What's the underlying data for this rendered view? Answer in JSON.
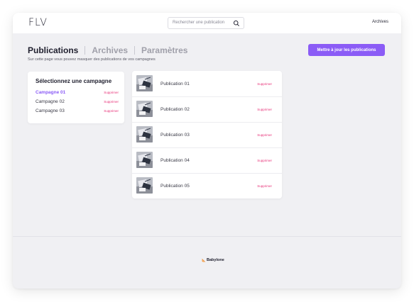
{
  "header": {
    "logo_text": "FLV",
    "search_placeholder": "Rechercher une publication",
    "archives_link": "Archives"
  },
  "tabs": [
    {
      "label": "Publications",
      "active": true
    },
    {
      "label": "Archives",
      "active": false
    },
    {
      "label": "Paramètres",
      "active": false
    }
  ],
  "subtitle": "Sur cette page vous pouvez masquer des publications de vos campagnes",
  "update_button": "Mettre à jour les publications",
  "campaigns": {
    "title": "Sélectionnez une campagne",
    "items": [
      {
        "name": "Campagne 01",
        "action": "Supprimer",
        "active": true
      },
      {
        "name": "Campagne 02",
        "action": "Supprimer",
        "active": false
      },
      {
        "name": "Campagne 03",
        "action": "Supprimer",
        "active": false
      }
    ]
  },
  "publications": [
    {
      "name": "Publication 01",
      "action": "Supprimer"
    },
    {
      "name": "Publication 02",
      "action": "Supprimer"
    },
    {
      "name": "Publication 03",
      "action": "Supprimer"
    },
    {
      "name": "Publication 04",
      "action": "Supprimer"
    },
    {
      "name": "Publication 05",
      "action": "Supprimer"
    }
  ],
  "footer": {
    "brand": "Babylone"
  },
  "colors": {
    "accent": "#8b5cf6",
    "danger": "#e8347a",
    "background": "#f0f0f3"
  }
}
